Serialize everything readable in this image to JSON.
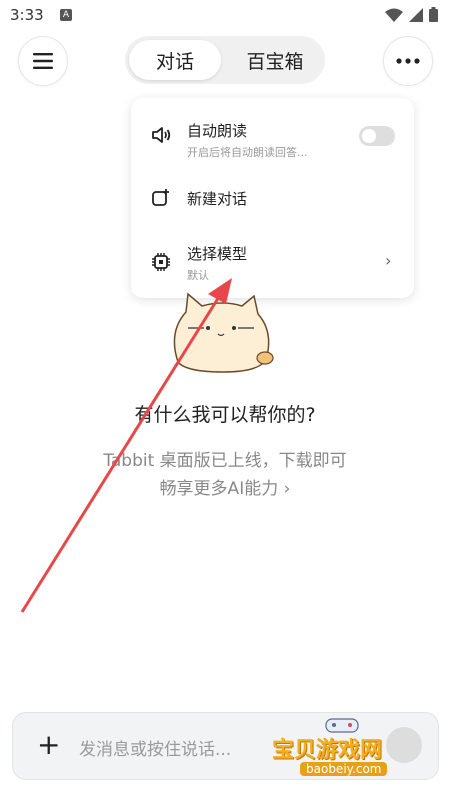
{
  "status": {
    "time": "3:33",
    "notif_letter": "A"
  },
  "header": {
    "tabs": [
      {
        "label": "对话"
      },
      {
        "label": "百宝箱"
      }
    ],
    "menu_icon": "hamburger-icon",
    "more_icon": "more-dots-icon"
  },
  "dropdown": {
    "auto_read": {
      "title": "自动朗读",
      "subtitle": "开启后将自动朗读回答...",
      "enabled": false,
      "icon": "speaker-icon"
    },
    "new_chat": {
      "title": "新建对话",
      "icon": "new-chat-icon"
    },
    "select_model": {
      "title": "选择模型",
      "subtitle": "默认",
      "icon": "chip-icon",
      "chevron": "›"
    }
  },
  "main": {
    "greeting": "有什么我可以帮你的?",
    "promo_line1": "Tabbit 桌面版已上线，下载即可",
    "promo_line2": "畅享更多AI能力 ›"
  },
  "input": {
    "placeholder": "发消息或按住说话...",
    "plus": "+"
  },
  "watermark": {
    "text": "宝贝游戏网",
    "url": "baobeiy.com"
  },
  "colors": {
    "arrow": "#e8474a",
    "accent_bg": "#f0f0f0"
  }
}
